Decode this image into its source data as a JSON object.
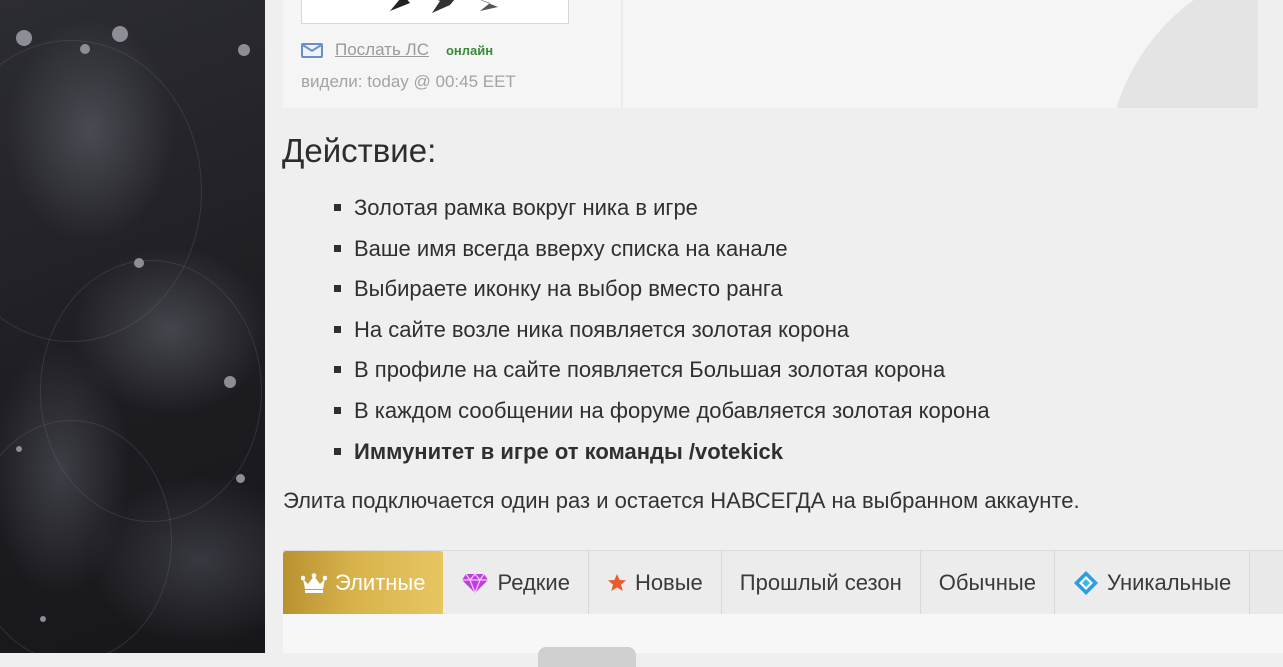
{
  "profile": {
    "pm_label": "Послать ЛС",
    "status": "онлайн",
    "last_seen": "видели: today @ 00:45 EET"
  },
  "main": {
    "title": "Действие:",
    "features": [
      "Золотая рамка вокруг ника в игре",
      "Ваше имя всегда вверху списка на канале",
      "Выбираете иконку на выбор вместо ранга",
      "На сайте возле ника появляется золотая корона",
      "В профиле на сайте появляется Большая золотая корона",
      "В каждом сообщении на форуме добавляется золотая корона",
      "Иммунитет в игре от команды /votekick"
    ],
    "note": "Элита подключается один раз и остается НАВСЕГДА на выбранном аккаунте."
  },
  "tabs": [
    {
      "label": "Элитные",
      "icon": "crown-icon"
    },
    {
      "label": "Редкие",
      "icon": "diamond-icon"
    },
    {
      "label": "Новые",
      "icon": "star-icon"
    },
    {
      "label": "Прошлый сезон",
      "icon": ""
    },
    {
      "label": "Обычные",
      "icon": ""
    },
    {
      "label": "Уникальные",
      "icon": "unique-gem-icon"
    }
  ],
  "colors": {
    "active_tab": "#c9a43f",
    "online": "#3a8a3a",
    "crown_gold": "#f2b520",
    "crown_gem": "#e0343a"
  }
}
